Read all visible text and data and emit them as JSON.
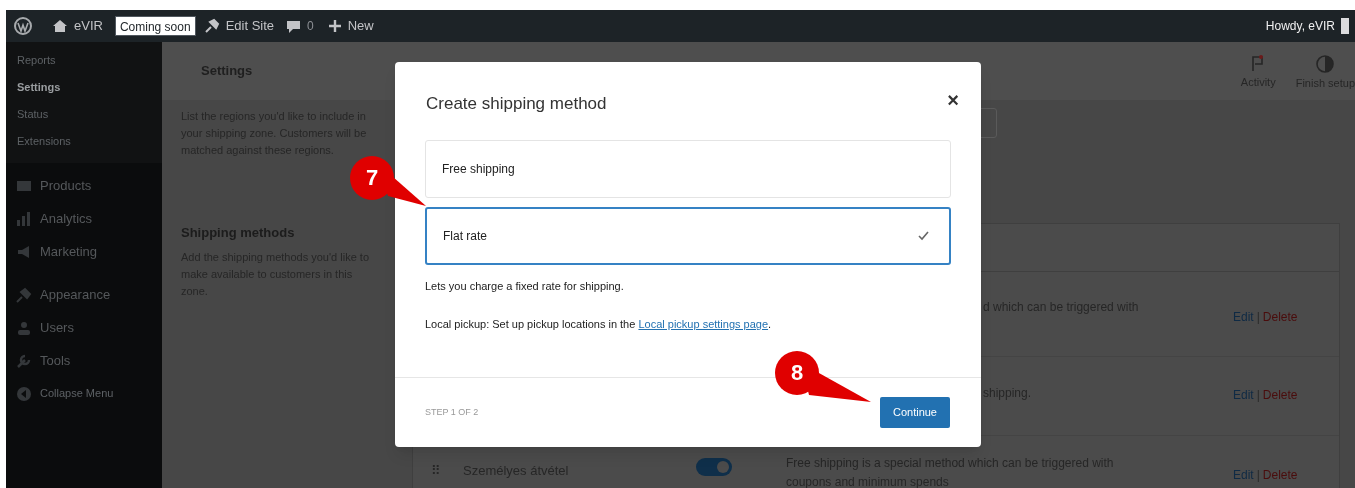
{
  "admin_bar": {
    "site_name": "eVIR",
    "coming_soon": "Coming soon",
    "edit_site": "Edit Site",
    "comments": "0",
    "new": "New",
    "greeting": "Howdy, eVIR"
  },
  "sidebar": {
    "submenu": [
      {
        "label": "Reports",
        "selected": false
      },
      {
        "label": "Settings",
        "selected": true
      },
      {
        "label": "Status",
        "selected": false
      },
      {
        "label": "Extensions",
        "selected": false
      }
    ],
    "items": [
      {
        "label": "Products"
      },
      {
        "label": "Analytics"
      },
      {
        "label": "Marketing"
      },
      {
        "label": "Appearance"
      },
      {
        "label": "Users"
      },
      {
        "label": "Tools"
      },
      {
        "label": "Collapse Menu"
      }
    ]
  },
  "header": {
    "title": "Settings",
    "actions": [
      {
        "label": "Activity"
      },
      {
        "label": "Finish setup"
      }
    ]
  },
  "zone_regions": {
    "description": "List the regions you'd like to include in your shipping zone. Customers will be matched against these regions."
  },
  "shipping_methods": {
    "title": "Shipping methods",
    "description": "Add the shipping methods you'd like to make available to customers in this zone.",
    "rows": [
      {
        "description": [
          "d which can be triggered with"
        ],
        "edit": "Edit",
        "separator": "|",
        "delete": "Delete"
      },
      {
        "description": [
          "shipping."
        ],
        "edit": "Edit",
        "separator": "|",
        "delete": "Delete"
      },
      {
        "handle": "⠿",
        "name": "Személyes átvétel",
        "enabled": true,
        "description": [
          "Free shipping is a special method which can be triggered with",
          "coupons and minimum spends"
        ],
        "edit": "Edit",
        "separator": "|",
        "delete": "Delete"
      }
    ]
  },
  "modal": {
    "title": "Create shipping method",
    "close": "×",
    "options": [
      {
        "label": "Free shipping",
        "selected": false
      },
      {
        "label": "Flat rate",
        "selected": true
      }
    ],
    "option_description": "Lets you charge a fixed rate for shipping.",
    "local_pickup": {
      "text": "Local pickup: Set up pickup locations in the ",
      "link": "Local pickup settings page",
      "suffix": "."
    },
    "step": "STEP 1 OF 2",
    "continue": "Continue"
  },
  "callouts": [
    {
      "label": "7"
    },
    {
      "label": "8"
    }
  ]
}
